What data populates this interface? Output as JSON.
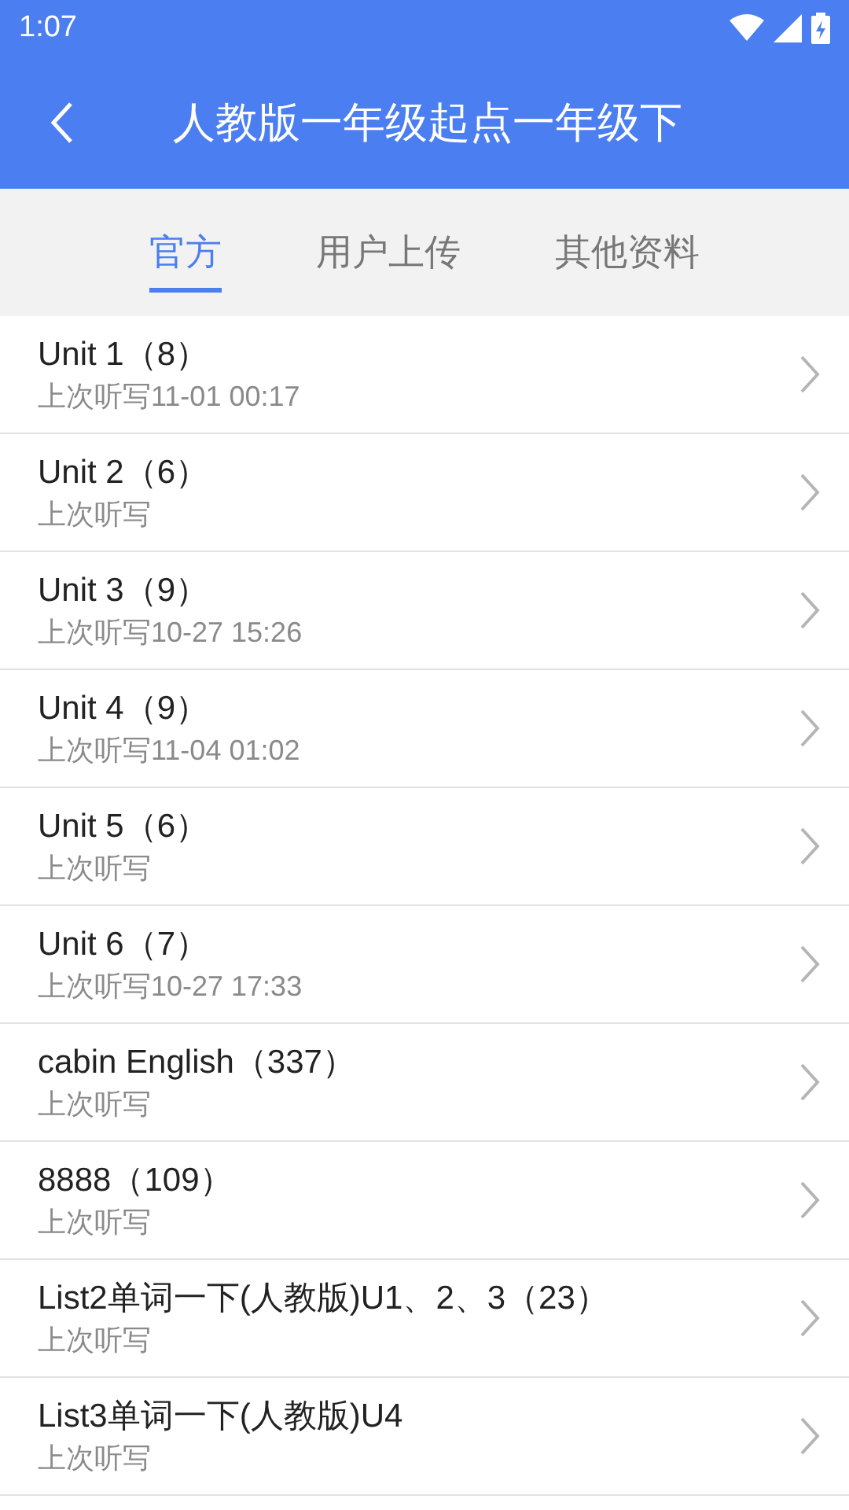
{
  "status_bar": {
    "time": "1:07"
  },
  "header": {
    "title": "人教版一年级起点一年级下"
  },
  "tabs": [
    {
      "label": "官方",
      "selected": true
    },
    {
      "label": "用户上传",
      "selected": false
    },
    {
      "label": "其他资料",
      "selected": false
    }
  ],
  "list": [
    {
      "title": "Unit 1（8）",
      "subtitle": "上次听写11-01 00:17"
    },
    {
      "title": "Unit 2（6）",
      "subtitle": "上次听写"
    },
    {
      "title": "Unit 3（9）",
      "subtitle": "上次听写10-27 15:26"
    },
    {
      "title": "Unit 4（9）",
      "subtitle": "上次听写11-04 01:02"
    },
    {
      "title": "Unit 5（6）",
      "subtitle": "上次听写"
    },
    {
      "title": "Unit 6（7）",
      "subtitle": "上次听写10-27 17:33"
    },
    {
      "title": "cabin English（337）",
      "subtitle": "上次听写"
    },
    {
      "title": "8888（109）",
      "subtitle": "上次听写"
    },
    {
      "title": "List2单词一下(人教版)U1、2、3（23）",
      "subtitle": "上次听写"
    },
    {
      "title": "List3单词一下(人教版)U4",
      "subtitle": "上次听写"
    }
  ]
}
